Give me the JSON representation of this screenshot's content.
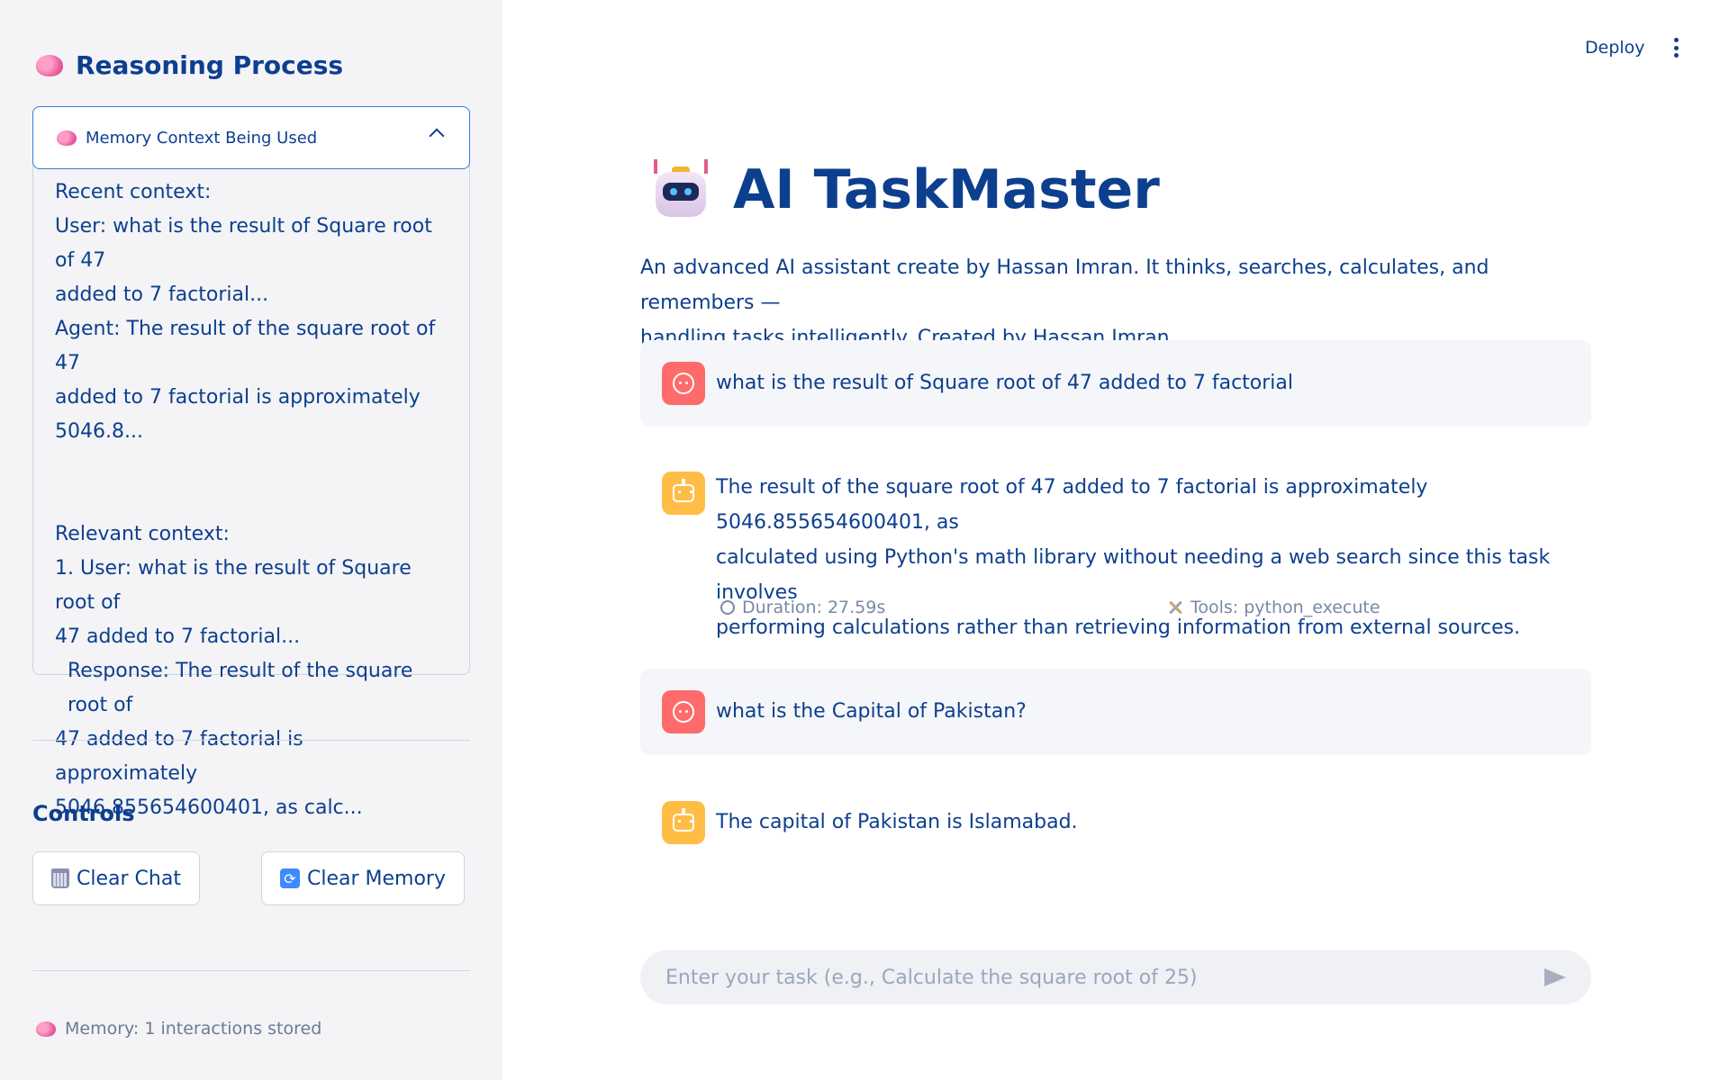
{
  "sidebar": {
    "title": "Reasoning Process",
    "expander": {
      "label": "Memory Context Being Used",
      "lines": [
        "Recent context:",
        "User: what is the result of Square root of 47",
        "added to 7 factorial...",
        "Agent: The result of the square root of 47",
        "added to 7 factorial is approximately",
        "5046.8...",
        "Relevant context:",
        "1. User: what is the result of Square root of",
        "47 added to 7 factorial...",
        "Response: The result of the square root of",
        "47 added to 7 factorial is approximately",
        "5046.855654600401, as calc..."
      ]
    },
    "controls_heading": "Controls",
    "clear_chat_label": "Clear Chat",
    "clear_memory_label": "Clear Memory",
    "memory_status": "Memory: 1 interactions stored"
  },
  "header": {
    "deploy_label": "Deploy"
  },
  "main": {
    "title": "AI TaskMaster",
    "subtitle_line1": "An advanced AI assistant create by Hassan Imran. It thinks, searches, calculates, and remembers —",
    "subtitle_line2": "handling tasks intelligently. Created by Hassan Imran.",
    "messages": [
      {
        "role": "user",
        "lines": [
          "what is the result of Square root of 47 added to 7 factorial"
        ]
      },
      {
        "role": "assistant",
        "lines": [
          "The result of the square root of 47 added to 7 factorial is approximately 5046.855654600401, as",
          "calculated using Python's math library without needing a web search since this task involves",
          "performing calculations rather than retrieving information from external sources."
        ],
        "duration": "Duration: 27.59s",
        "tools": "Tools: python_execute"
      },
      {
        "role": "user",
        "lines": [
          "what is the Capital of Pakistan?"
        ]
      },
      {
        "role": "assistant",
        "lines": [
          "The capital of Pakistan is Islamabad."
        ]
      }
    ],
    "input_placeholder": "Enter your task (e.g., Calculate the square root of 25)"
  },
  "colors": {
    "primary_text": "#0d3f8f",
    "user_avatar": "#ff6b6b",
    "bot_avatar": "#ffbd45",
    "sidebar_bg": "#f4f4f6"
  },
  "icons": [
    "brain-icon",
    "chevron-up-icon",
    "trash-icon",
    "refresh-icon",
    "robot-icon",
    "user-face-icon",
    "bot-icon",
    "stopwatch-icon",
    "tools-icon",
    "send-icon",
    "menu-dots-icon"
  ]
}
